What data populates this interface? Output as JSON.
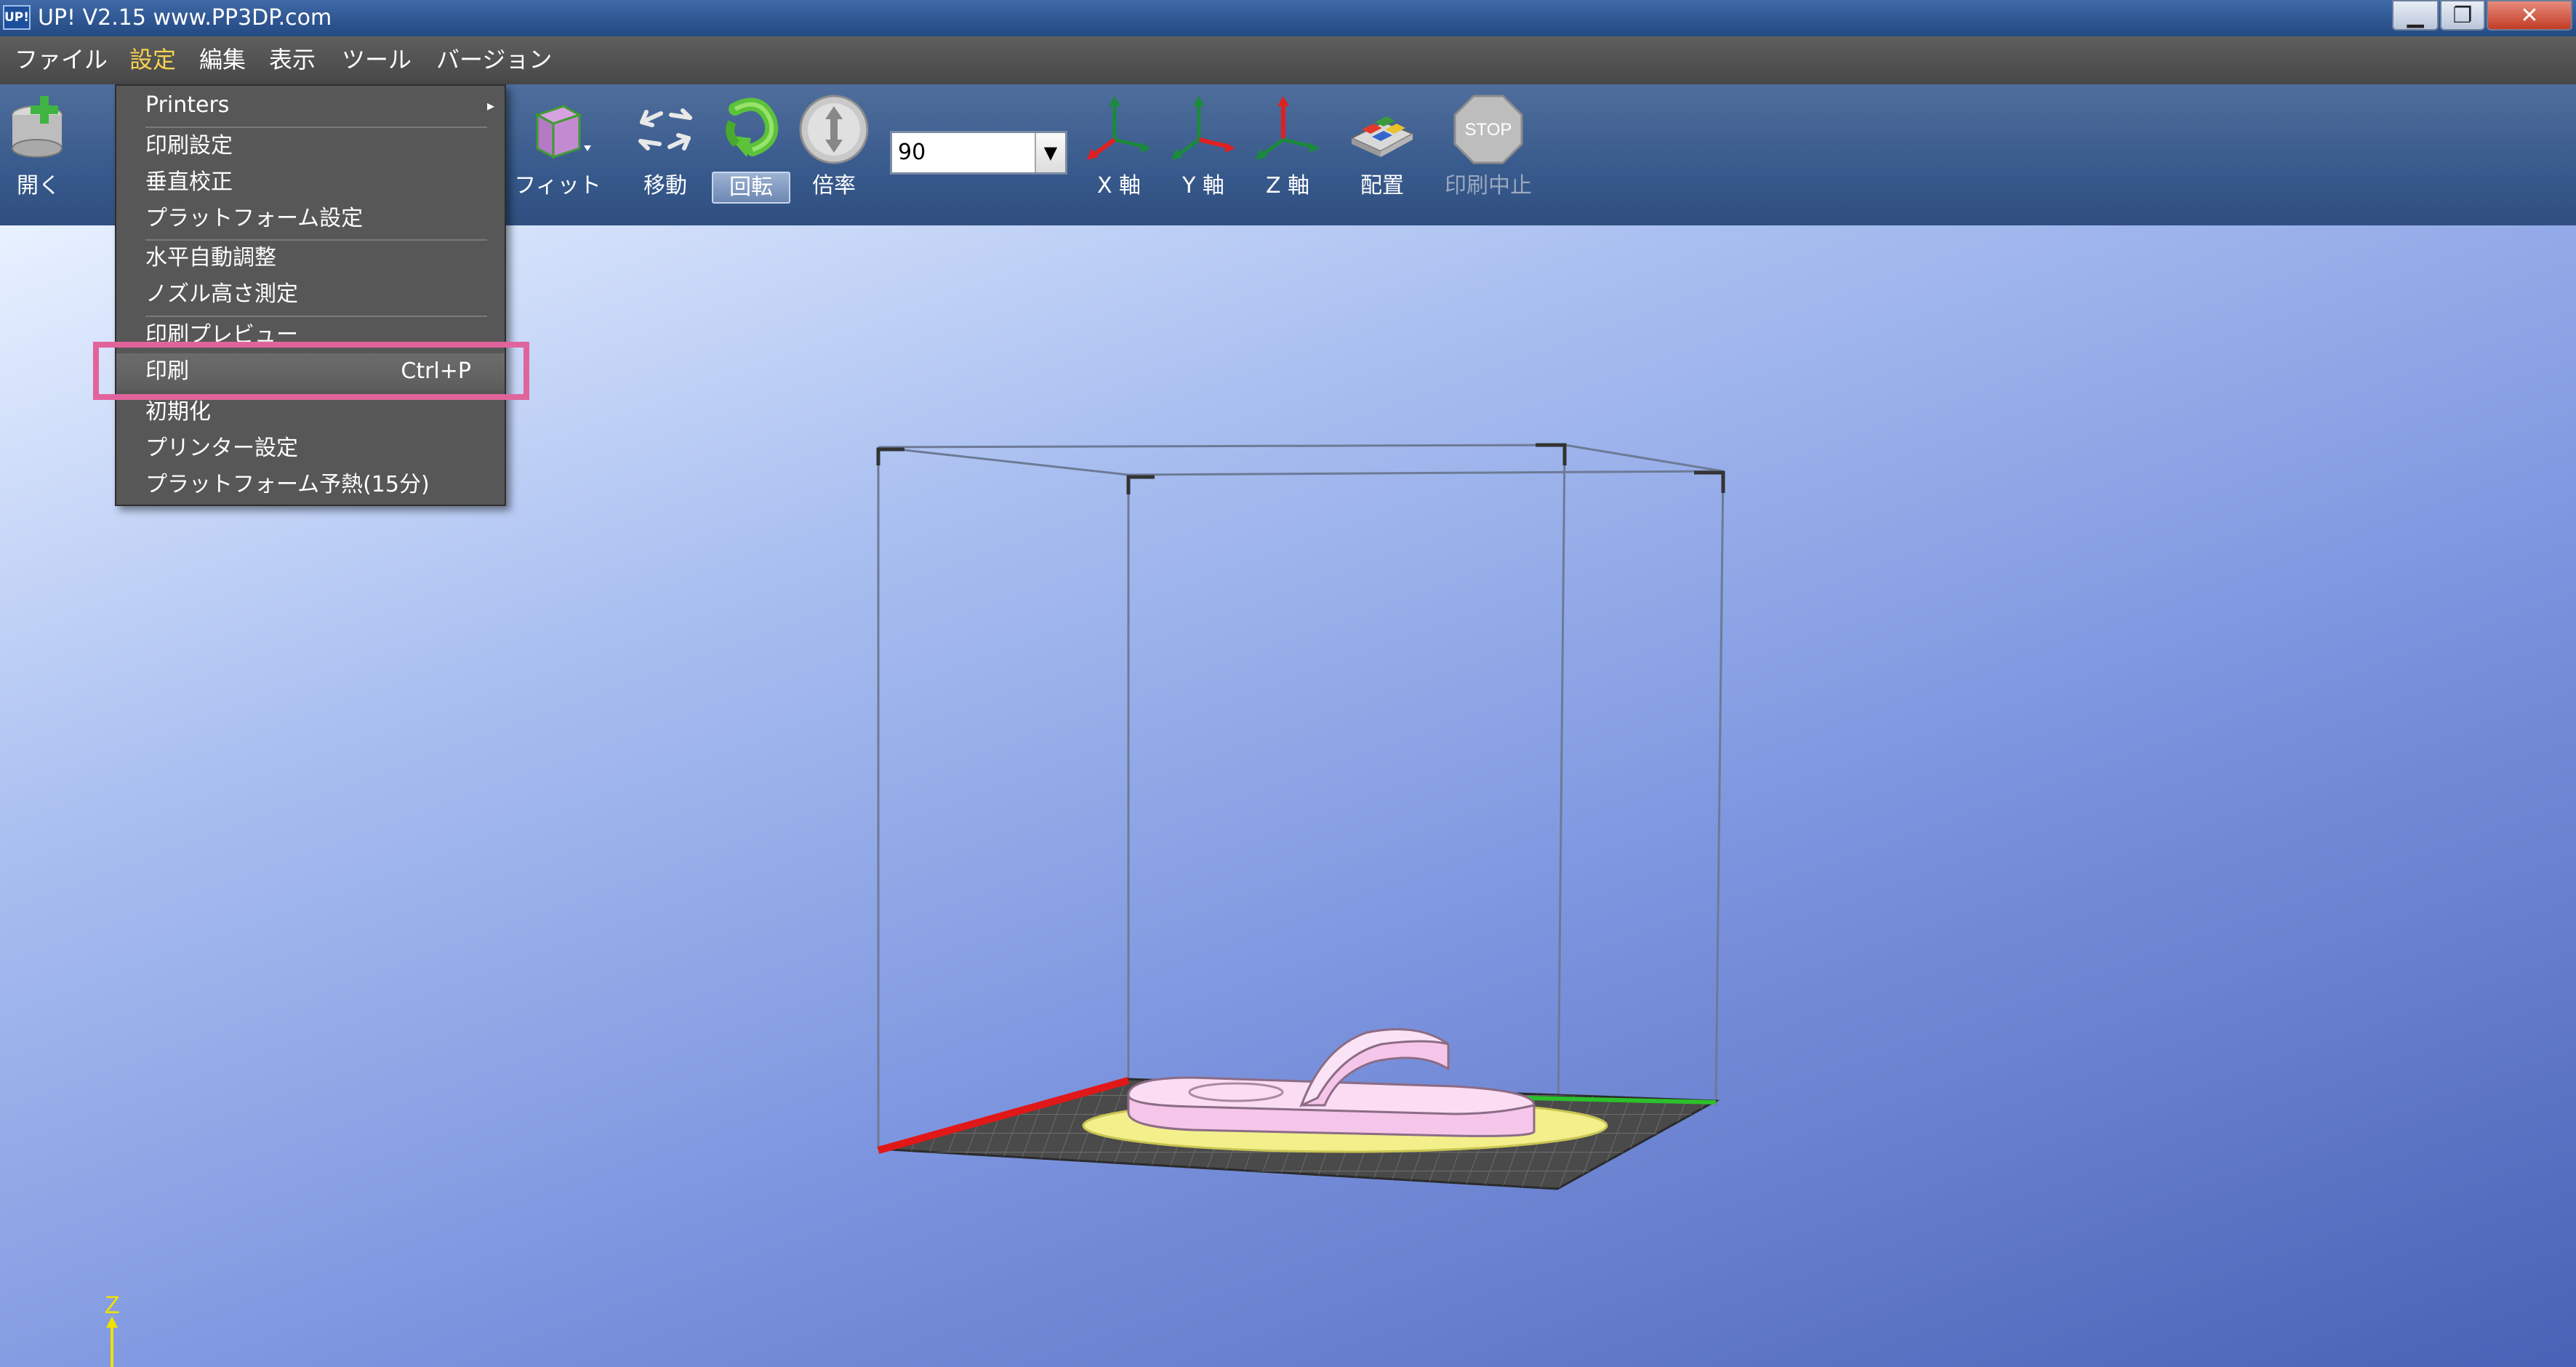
{
  "window": {
    "app_icon_text": "UP!",
    "title": "UP!  V2.15 www.PP3DP.com",
    "min_glyph": "▁",
    "max_glyph": "❐",
    "close_glyph": "✕"
  },
  "menubar": {
    "items": [
      "ファイル",
      "設定",
      "編集",
      "表示",
      "ツール",
      "バージョン"
    ],
    "active_index": 1
  },
  "toolbar": {
    "open_label": "開く",
    "fit_label": "フィット",
    "move_label": "移動",
    "rotate_label": "回転",
    "scale_label": "倍率",
    "zoom_value": "90",
    "zoom_arrow": "▼",
    "x_axis_label": "X 軸",
    "y_axis_label": "Y 軸",
    "z_axis_label": "Z 軸",
    "arrange_label": "配置",
    "stop_label": "印刷中止",
    "stop_icon_text": "STOP",
    "selected_tool": "回転"
  },
  "settings_menu": {
    "printers_label": "Printers",
    "submenu_arrow": "▸",
    "items": [
      {
        "label": "印刷設定"
      },
      {
        "label": "垂直校正"
      },
      {
        "label": "プラットフォーム設定"
      },
      {
        "label": "水平自動調整"
      },
      {
        "label": "ノズル高さ測定"
      },
      {
        "label": "印刷プレビュー"
      },
      {
        "label": "印刷",
        "shortcut": "Ctrl+P"
      },
      {
        "label": "初期化"
      },
      {
        "label": "プリンター設定"
      },
      {
        "label": "プラットフォーム予熱(15分)"
      }
    ],
    "highlighted_item": "印刷"
  },
  "viewport": {
    "axis_indicator_label": "Z"
  },
  "colors": {
    "menu_active": "#f6d24f",
    "highlight_annotation": "#e0649b",
    "model_fill": "#f5c6ea",
    "raft_fill": "#f3ef8a"
  }
}
